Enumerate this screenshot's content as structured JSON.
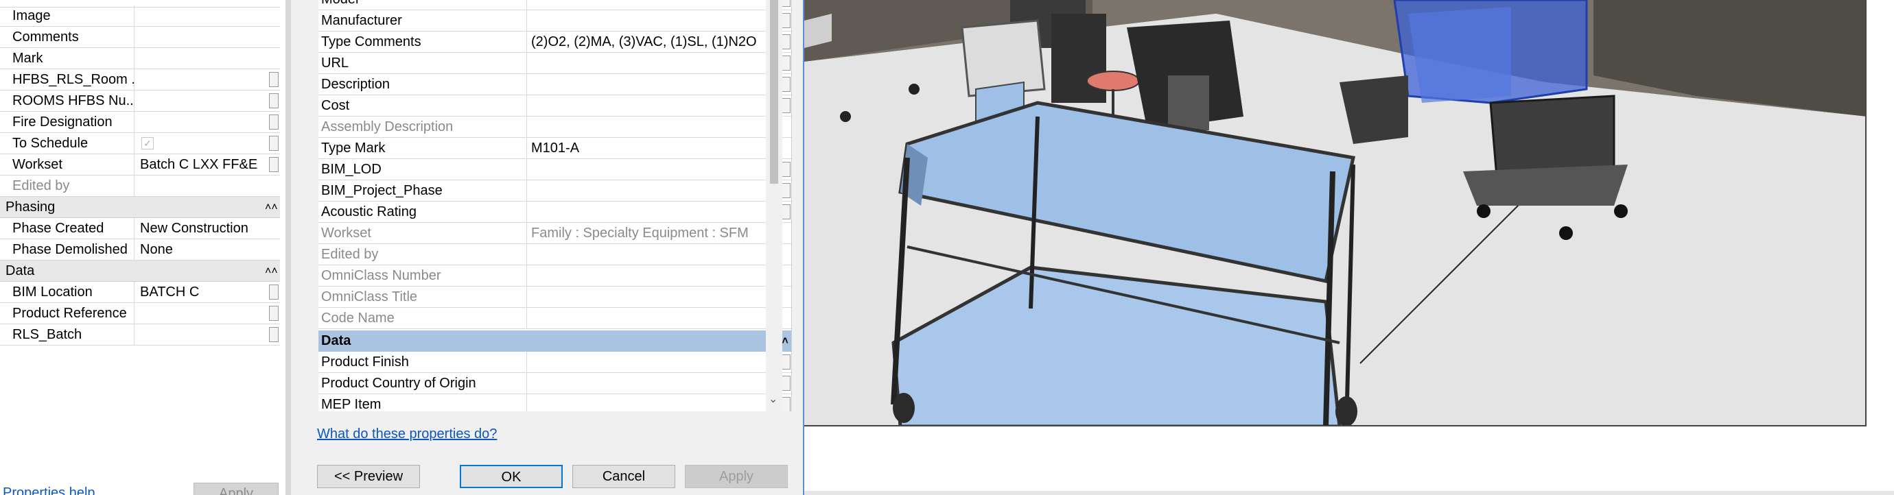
{
  "left_panel": {
    "rows_top": [
      {
        "name": "Image",
        "value": ""
      },
      {
        "name": "Comments",
        "value": ""
      },
      {
        "name": "Mark",
        "value": ""
      },
      {
        "name": "HFBS_RLS_Room ...",
        "value": ""
      },
      {
        "name": "ROOMS HFBS Nu...",
        "value": ""
      },
      {
        "name": "Fire Designation",
        "value": ""
      },
      {
        "name": "To Schedule",
        "value": ""
      },
      {
        "name": "Workset",
        "value": "Batch C LXX FF&E"
      },
      {
        "name": "Edited by",
        "value": ""
      }
    ],
    "group_phasing": "Phasing",
    "rows_phasing": [
      {
        "name": "Phase Created",
        "value": "New Construction"
      },
      {
        "name": "Phase Demolished",
        "value": "None"
      }
    ],
    "group_data": "Data",
    "rows_data": [
      {
        "name": "BIM Location",
        "value": "BATCH C"
      },
      {
        "name": "Product Reference",
        "value": ""
      },
      {
        "name": "RLS_Batch",
        "value": ""
      }
    ],
    "help_link": "Properties help",
    "apply_label": "Apply",
    "check_glyph": "✓"
  },
  "dialog": {
    "rows": [
      {
        "name": "Model",
        "value": ""
      },
      {
        "name": "Manufacturer",
        "value": ""
      },
      {
        "name": "Type Comments",
        "value": "(2)O2, (2)MA, (3)VAC, (1)SL, (1)N2O"
      },
      {
        "name": "URL",
        "value": ""
      },
      {
        "name": "Description",
        "value": ""
      },
      {
        "name": "Cost",
        "value": ""
      },
      {
        "name": "Assembly Description",
        "value": ""
      },
      {
        "name": "Type Mark",
        "value": "M101-A"
      },
      {
        "name": "BIM_LOD",
        "value": ""
      },
      {
        "name": "BIM_Project_Phase",
        "value": ""
      },
      {
        "name": "Acoustic Rating",
        "value": ""
      },
      {
        "name": "Workset",
        "value": "Family  : Specialty Equipment : SFM"
      },
      {
        "name": "Edited by",
        "value": ""
      },
      {
        "name": "OmniClass Number",
        "value": ""
      },
      {
        "name": "OmniClass Title",
        "value": ""
      },
      {
        "name": "Code Name",
        "value": ""
      }
    ],
    "group_data": "Data",
    "data_rows": [
      {
        "name": "Product Finish",
        "value": ""
      },
      {
        "name": "Product Country of Origin",
        "value": ""
      },
      {
        "name": "MEP Item",
        "value": ""
      }
    ],
    "help_link": "What do these properties do?",
    "buttons": {
      "preview": "<< Preview",
      "ok": "OK",
      "cancel": "Cancel",
      "apply": "Apply"
    },
    "collapse_glyph": "⌃",
    "scroll_down_glyph": "⌄"
  },
  "colors": {
    "group_header_blue": "#a9c3e0",
    "selection_blue": "#3f63d6",
    "shelf_blue": "#9fc0e6",
    "link_blue": "#0b57c0",
    "ok_border": "#0078d7"
  }
}
